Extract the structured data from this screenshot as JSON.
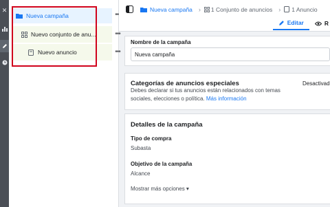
{
  "tree": {
    "campaign_label": "Nueva campaña",
    "adset_label": "Nuevo conjunto de anu...",
    "ad_label": "Nuevo anuncio",
    "more_label": "•••"
  },
  "breadcrumb": {
    "campaign": "Nueva campaña",
    "adset": "1 Conjunto de anuncios",
    "ad": "1 Anuncio"
  },
  "tabs": {
    "edit_label": "Editar",
    "review_label": "R"
  },
  "campaign_name": {
    "label": "Nombre de la campaña",
    "value": "Nueva campaña"
  },
  "special_categories": {
    "title": "Categorías de anuncios especiales",
    "status": "Desactivad",
    "description_line1": "Debes declarar si tus anuncios están relacionados con temas",
    "description_line2": "sociales, elecciones o política.",
    "more_info_link": "Más información"
  },
  "campaign_details": {
    "title": "Detalles de la campaña",
    "buy_type_label": "Tipo de compra",
    "buy_type_value": "Subasta",
    "objective_label": "Objetivo de la campaña",
    "objective_value": "Alcance",
    "show_more_link": "Mostrar más opciones ▾"
  },
  "colors": {
    "accent": "#1877f2",
    "highlight_border": "#d0021b",
    "rail": "#4b4f56"
  },
  "icons": [
    "close-icon",
    "chart-icon",
    "pencil-icon",
    "clock-icon",
    "folder-icon",
    "adset-grid-icon",
    "ad-square-icon",
    "sidebar-toggle-icon",
    "eye-icon"
  ]
}
